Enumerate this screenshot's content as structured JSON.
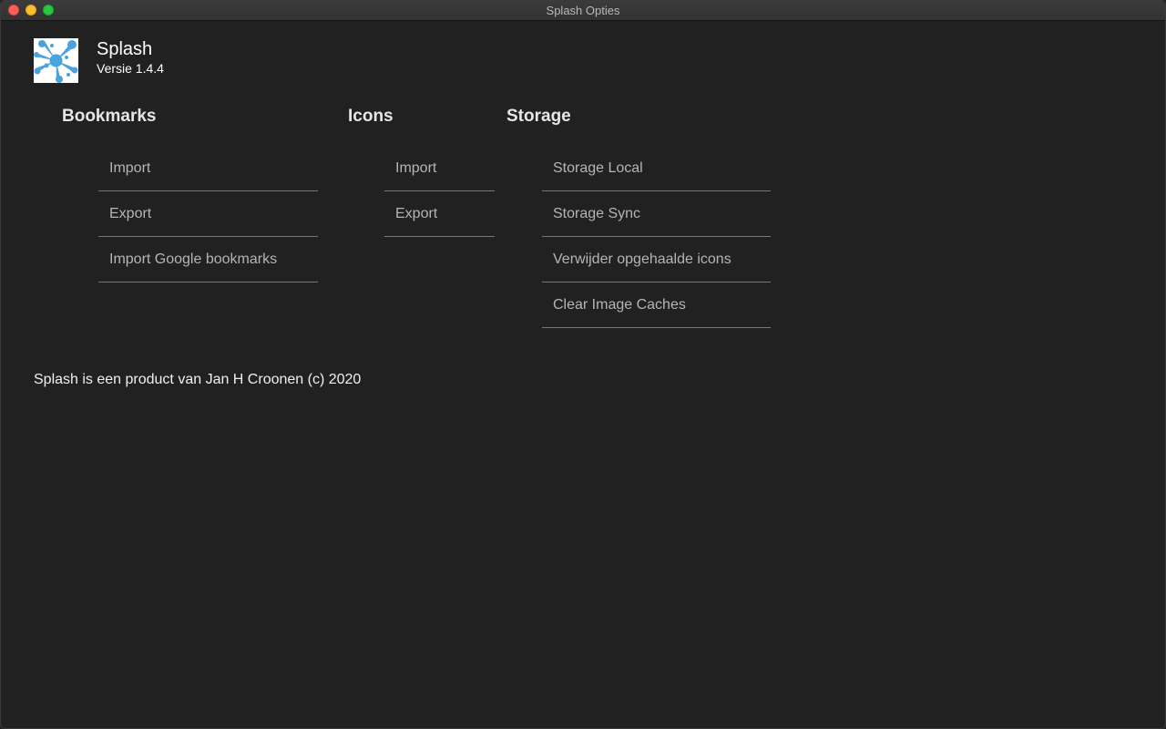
{
  "window": {
    "title": "Splash Opties"
  },
  "app": {
    "name": "Splash",
    "version": "Versie 1.4.4",
    "logo_icon": "splash-logo-icon",
    "logo_color": "#4aa3df"
  },
  "sections": {
    "bookmarks": {
      "title": "Bookmarks",
      "items": [
        "Import",
        "Export",
        "Import Google bookmarks"
      ]
    },
    "icons": {
      "title": "Icons",
      "items": [
        "Import",
        "Export"
      ]
    },
    "storage": {
      "title": "Storage",
      "items": [
        "Storage Local",
        "Storage Sync",
        "Verwijder opgehaalde icons",
        "Clear Image Caches"
      ]
    }
  },
  "footer": {
    "text": "Splash is een product van Jan H Croonen (c) 2020"
  }
}
